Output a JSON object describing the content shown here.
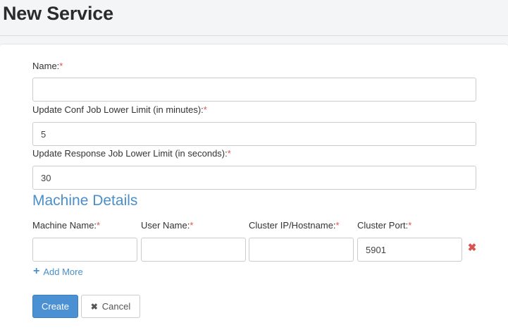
{
  "header": {
    "title": "New Service"
  },
  "form": {
    "name": {
      "label": "Name:",
      "required_mark": "*",
      "value": ""
    },
    "conf_limit": {
      "label": "Update Conf Job Lower Limit (in minutes):",
      "required_mark": "*",
      "value": "5"
    },
    "response_limit": {
      "label": "Update Response Job Lower Limit (in seconds):",
      "required_mark": "*",
      "value": "30"
    }
  },
  "machine_details": {
    "title": "Machine Details",
    "columns": [
      {
        "label": "Machine Name:",
        "required_mark": "*"
      },
      {
        "label": "User Name:",
        "required_mark": "*"
      },
      {
        "label": "Cluster IP/Hostname:",
        "required_mark": "*"
      },
      {
        "label": "Cluster Port:",
        "required_mark": "*"
      }
    ],
    "row": {
      "machine_name": "",
      "user_name": "",
      "cluster_ip": "",
      "cluster_port": "5901"
    },
    "remove_icon": "✖",
    "add_more_icon": "+",
    "add_more_label": "Add More"
  },
  "actions": {
    "create_label": "Create",
    "cancel_icon": "✖",
    "cancel_label": "Cancel"
  },
  "colors": {
    "accent": "#4a90d2",
    "required": "#d9534f",
    "link": "#4a8fc9"
  }
}
